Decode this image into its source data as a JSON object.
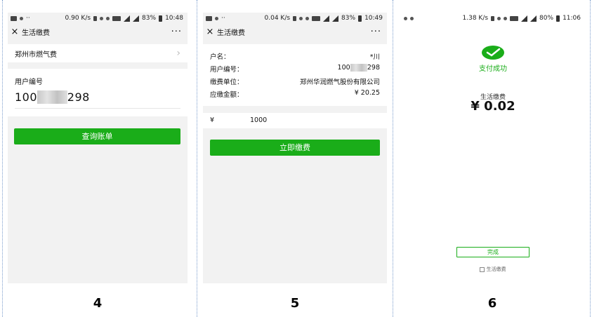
{
  "screen4": {
    "status": {
      "speed": "0.90 K/s",
      "battery": "83%",
      "time": "10:48"
    },
    "nav": {
      "close_icon": "×",
      "title": "生活缴费",
      "more": "···"
    },
    "city_item": "郑州市燃气费",
    "chevron": "›",
    "user_no_label": "用户编号",
    "user_no_prefix": "100",
    "user_no_suffix": "298",
    "query_button": "查询账单",
    "step": "4"
  },
  "screen5": {
    "status": {
      "speed": "0.04 K/s",
      "battery": "83%",
      "time": "10:49"
    },
    "nav": {
      "close_icon": "×",
      "title": "生活缴费",
      "more": "···"
    },
    "rows": [
      {
        "label": "户名：",
        "value": "*川"
      },
      {
        "label": "用户编号：",
        "value_prefix": "100",
        "value_suffix": "298"
      },
      {
        "label": "缴费单位：",
        "value": "郑州华润燃气股份有限公司"
      },
      {
        "label": "应缴金额：",
        "value": "¥ 20.25"
      }
    ],
    "currency": "¥",
    "amount": "1000",
    "pay_button": "立即缴费",
    "step": "5"
  },
  "screen6": {
    "status": {
      "speed": "1.38 K/s",
      "battery": "80%",
      "time": "11:06"
    },
    "success_text": "支付成功",
    "service": "生活缴费",
    "amount": "¥ 0.02",
    "done_button": "完成",
    "footer_link": "生活缴费",
    "step": "6"
  },
  "colors": {
    "accent": "#1aad19",
    "bg_gray": "#f2f2f2"
  }
}
